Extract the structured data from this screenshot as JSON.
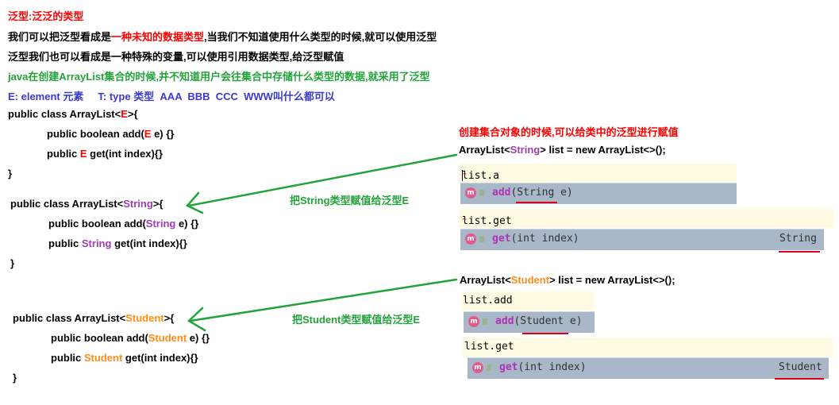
{
  "notes": {
    "line1": "泛型:泛泛的类型",
    "line2_a": "我们可以把泛型看成是",
    "line2_b": "一种未知的数据类型",
    "line2_c": ",当我们不知道使用什么类型的时候,就可以使用泛型",
    "line3": "泛型我们也可以看成是一种特殊的变量,可以使用引用数据类型,给泛型赋值",
    "line4": "java在创建ArrayList集合的时候,并不知道用户会往集合中存储什么类型的数据,就采用了泛型",
    "line5": "E: element 元素     T: type 类型  AAA  BBB  CCC  WWW叫什么都可以"
  },
  "code_generic": {
    "decl_a": "public class ArrayList<",
    "type": "E",
    "decl_b": ">{",
    "add_a": "public boolean add(",
    "add_b": " e) {}",
    "get_a": "public ",
    "get_b": " get(int index){}",
    "close": "}"
  },
  "code_string": {
    "decl_a": "public class ArrayList<",
    "type": "String",
    "decl_b": ">{",
    "add_a": "public boolean add(",
    "add_b": " e) {}",
    "get_a": "public ",
    "get_b": " get(int index){}",
    "close": "}"
  },
  "code_student": {
    "decl_a": "public class ArrayList<",
    "type": "Student",
    "decl_b": ">{",
    "add_a": "public boolean add(",
    "add_b": " e) {}",
    "get_a": "public ",
    "get_b": " get(int index){}",
    "close": "}"
  },
  "arrows": {
    "string_label": "把String类型赋值给泛型E",
    "student_label": "把Student类型赋值给泛型E"
  },
  "right": {
    "heading": "创建集合对象的时候,可以给类中的泛型进行赋值",
    "string_decl_a": "ArrayList<",
    "string_type": "String",
    "string_decl_b": "> list = new ArrayList<>();",
    "student_decl_a": "ArrayList<",
    "student_type": "Student",
    "student_decl_b": "> list = new ArrayList<>();"
  },
  "ide": {
    "input1": "list.a",
    "sugg1_name": "add",
    "sugg1_params": "(String e)",
    "input2": "list.get",
    "sugg2_name": "get",
    "sugg2_params": "(int index)",
    "sugg2_ret": "String",
    "input3": "list.add",
    "sugg3_name": "add",
    "sugg3_params": "(Student e)",
    "input4": "list.get",
    "sugg4_name": "get",
    "sugg4_params": "(int index)",
    "sugg4_ret": "Student",
    "method_icon": "m"
  },
  "colors": {
    "red": "#ff0000",
    "green": "#22a33a",
    "blue": "#3a3ad0",
    "purple": "#a03cb4",
    "orange": "#ff8c1a",
    "suggestion_bg": "#a8b8c8",
    "input_bg": "#fffbe3"
  }
}
